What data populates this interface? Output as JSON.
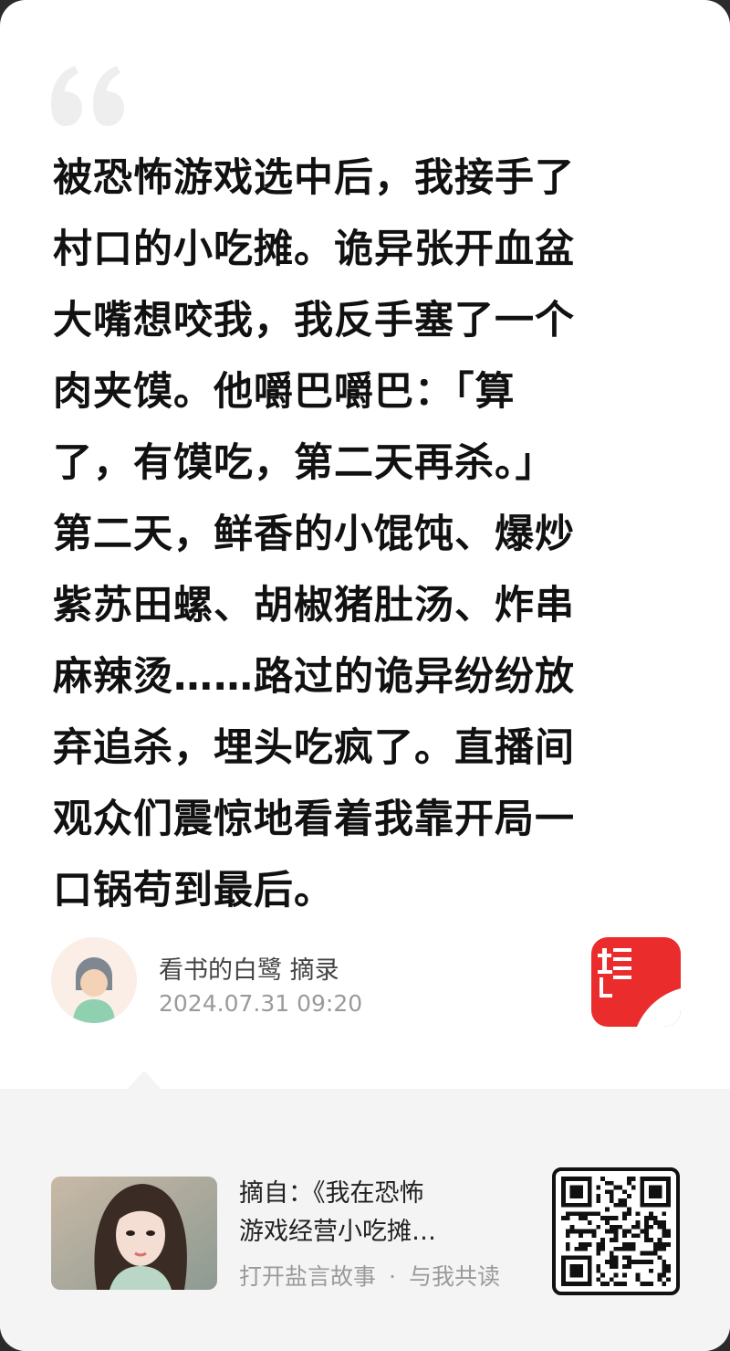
{
  "excerpt": {
    "text": "被恐怖游戏选中后，我接手了\n村口的小吃摊。诡异张开血盆\n大嘴想咬我，我反手塞了一个\n肉夹馍。他嚼巴嚼巴：「算\n了，有馍吃，第二天再杀。」\n第二天，鲜香的小馄饨、爆炒\n紫苏田螺、胡椒猪肚汤、炸串\n麻辣烫……路过的诡异纷纷放\n弃追杀，埋头吃疯了。直播间\n观众们震惊地看着我靠开局一\n口锅苟到最后。"
  },
  "author": {
    "name": "看书的白鹭 摘录",
    "time": "2024.07.31 09:20"
  },
  "app": {
    "logo_text": "盐言",
    "brand_color": "#ea2c2c"
  },
  "source": {
    "line1": "摘自：《我在恐怖",
    "line2": "游戏经营小吃摊…",
    "open_label": "打开盐言故事",
    "separator": "·",
    "read_label": "与我共读"
  },
  "icons": {
    "quote": "quote-mark-icon",
    "avatar": "avatar-icon",
    "qr": "qr-code-icon"
  }
}
